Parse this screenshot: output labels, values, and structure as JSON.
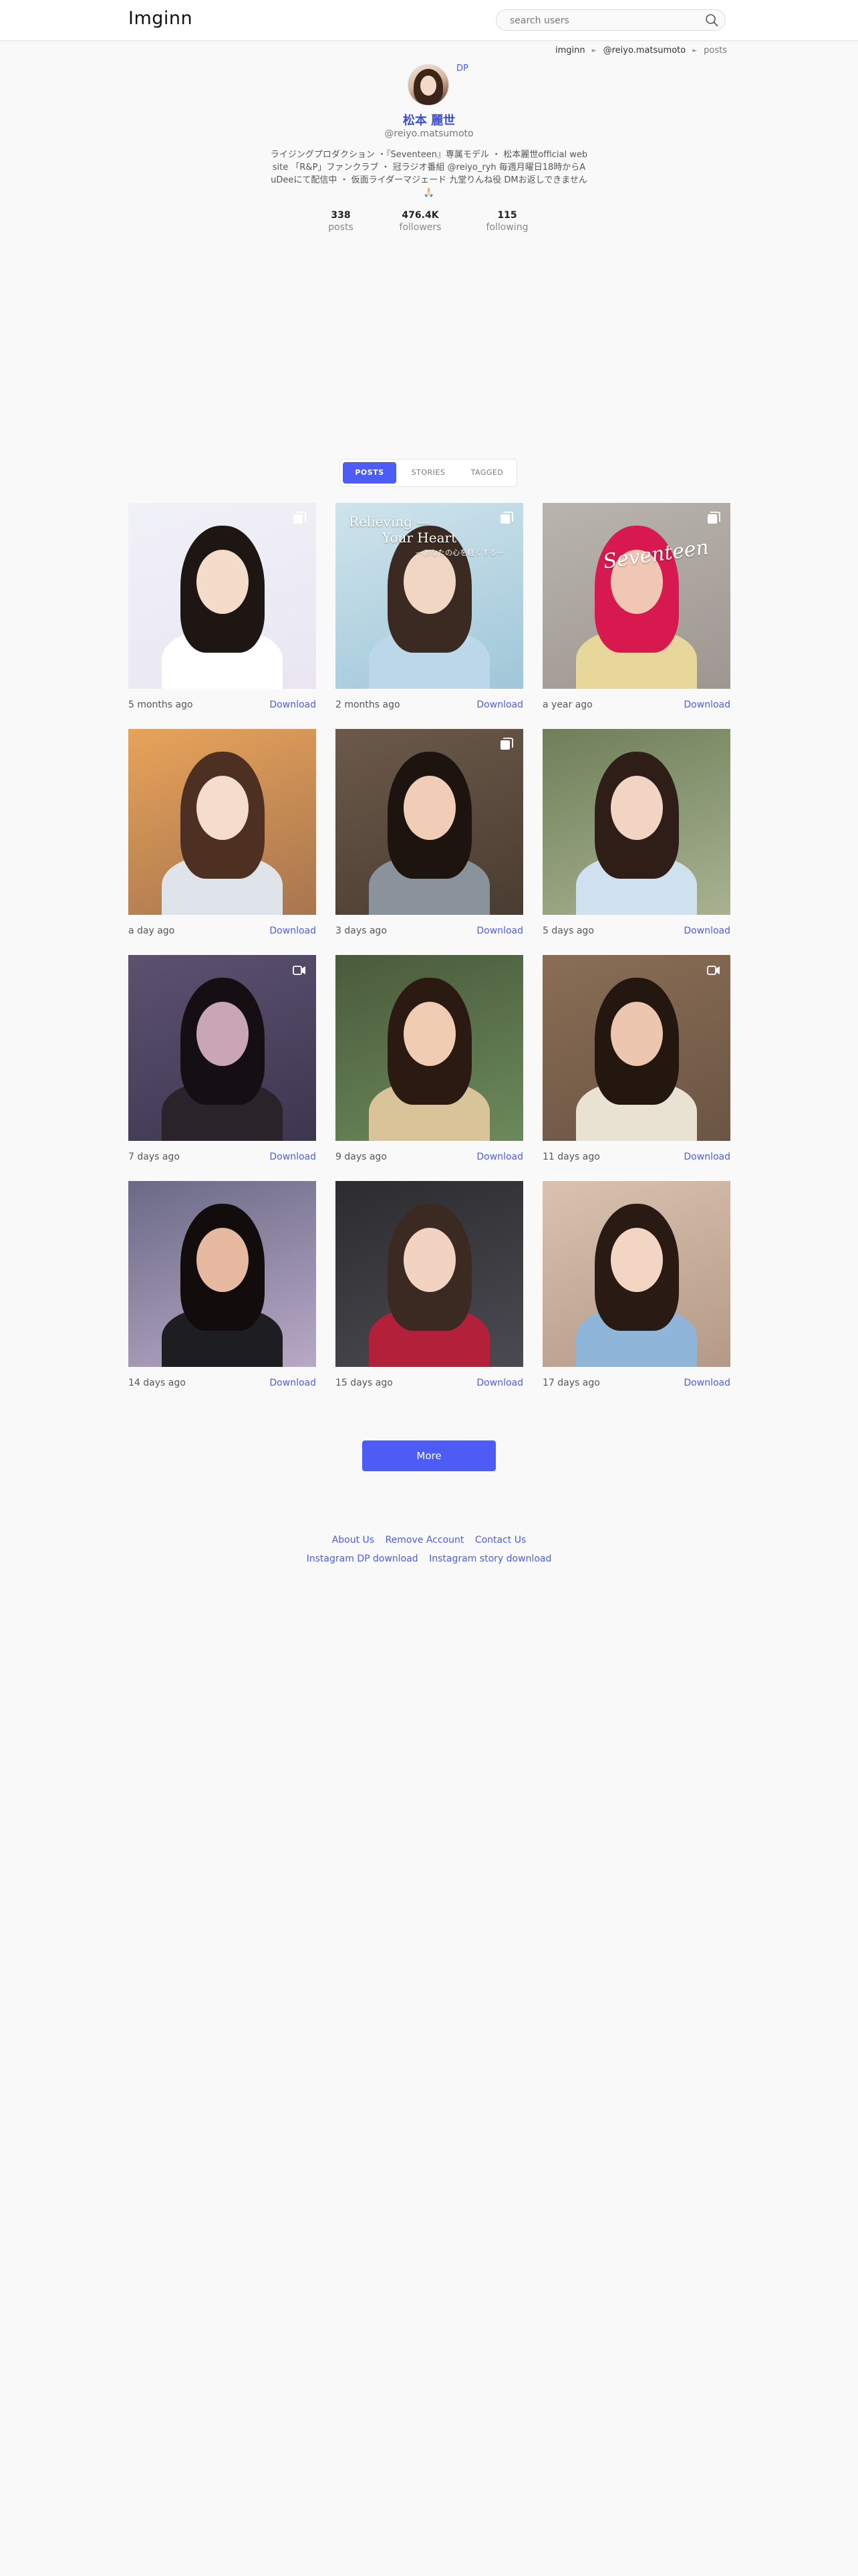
{
  "header": {
    "logo": "Imginn",
    "search_placeholder": "search users"
  },
  "breadcrumb": {
    "items": [
      "imginn",
      "@reiyo.matsumoto",
      "posts"
    ]
  },
  "profile": {
    "dp_label": "DP",
    "name": "松本 麗世",
    "handle": "@reiyo.matsumoto",
    "bio": "ライジングプロダクション ・『Seventeen』専属モデル ・ 松本麗世official website 「R&P」ファンクラブ ・ 冠ラジオ番組 @reiyo_ryh 毎週月曜日18時からAuDeeにて配信中 ・ 仮面ライダーマジェード 九堂りんね役 DMお返しできません🙏🏻",
    "stats": [
      {
        "value": "338",
        "label": "posts"
      },
      {
        "value": "476.4K",
        "label": "followers"
      },
      {
        "value": "115",
        "label": "following"
      }
    ]
  },
  "tabs": [
    {
      "label": "POSTS",
      "active": true
    },
    {
      "label": "STORIES",
      "active": false
    },
    {
      "label": "TAGGED",
      "active": false
    }
  ],
  "posts": [
    {
      "time": "5 months ago",
      "download": "Download",
      "badge": "carousel-icon",
      "palette": [
        "#f1f1f8",
        "#e9e6f2",
        "#1e1612",
        "#f4dccb",
        "#ffffff"
      ]
    },
    {
      "time": "2 months ago",
      "download": "Download",
      "badge": "carousel-icon",
      "palette": [
        "#cfe4ec",
        "#9fc7d8",
        "#3a2a22",
        "#f2d6c4",
        "#bcd7ea"
      ],
      "overlay": [
        "Relieving —",
        "Your Heart",
        "—あなたの心を軽くする—"
      ]
    },
    {
      "time": "a year ago",
      "download": "Download",
      "badge": "carousel-icon",
      "palette": [
        "#b9b4ad",
        "#9d9790",
        "#d8194f",
        "#f0c7b4",
        "#e8d79b"
      ],
      "overlay": [
        "Seventeen"
      ]
    },
    {
      "time": "a day ago",
      "download": "Download",
      "badge": "",
      "palette": [
        "#e7a35a",
        "#a7754f",
        "#4d3022",
        "#f5dccc",
        "#dfe4ea"
      ]
    },
    {
      "time": "3 days ago",
      "download": "Download",
      "badge": "carousel-icon",
      "palette": [
        "#6b5a4b",
        "#4a3c30",
        "#1d1410",
        "#f1cdb8",
        "#8a939c"
      ]
    },
    {
      "time": "5 days ago",
      "download": "Download",
      "badge": "",
      "palette": [
        "#6f7f5a",
        "#a8b290",
        "#2e1e17",
        "#f2d4c2",
        "#cfe0ef"
      ]
    },
    {
      "time": "7 days ago",
      "download": "Download",
      "badge": "video-icon",
      "palette": [
        "#5c5270",
        "#3d3650",
        "#150f14",
        "#c9a6b3",
        "#2a2329"
      ]
    },
    {
      "time": "9 days ago",
      "download": "Download",
      "badge": "",
      "palette": [
        "#4a5a3c",
        "#6b8a5a",
        "#2a1a12",
        "#f0cdb2",
        "#d9c49a"
      ]
    },
    {
      "time": "11 days ago",
      "download": "Download",
      "badge": "video-icon",
      "palette": [
        "#8a6e55",
        "#6a5544",
        "#241710",
        "#ecc6ae",
        "#e9e2d2"
      ]
    },
    {
      "time": "14 days ago",
      "download": "Download",
      "badge": "",
      "palette": [
        "#6a6a86",
        "#b8a9c6",
        "#120c0c",
        "#e6b9a0",
        "#1e1e22"
      ]
    },
    {
      "time": "15 days ago",
      "download": "Download",
      "badge": "",
      "palette": [
        "#2c2c30",
        "#4a4a50",
        "#3a2a22",
        "#f2d3c2",
        "#b3203a"
      ]
    },
    {
      "time": "17 days ago",
      "download": "Download",
      "badge": "",
      "palette": [
        "#d9c2b0",
        "#b49a86",
        "#2a1a14",
        "#f3d5c3",
        "#8fb5d8"
      ]
    }
  ],
  "more_label": "More",
  "footer": {
    "row1": [
      "About Us",
      "Remove Account",
      "Contact Us"
    ],
    "row2": [
      "Instagram DP download",
      "Instagram story download"
    ]
  }
}
